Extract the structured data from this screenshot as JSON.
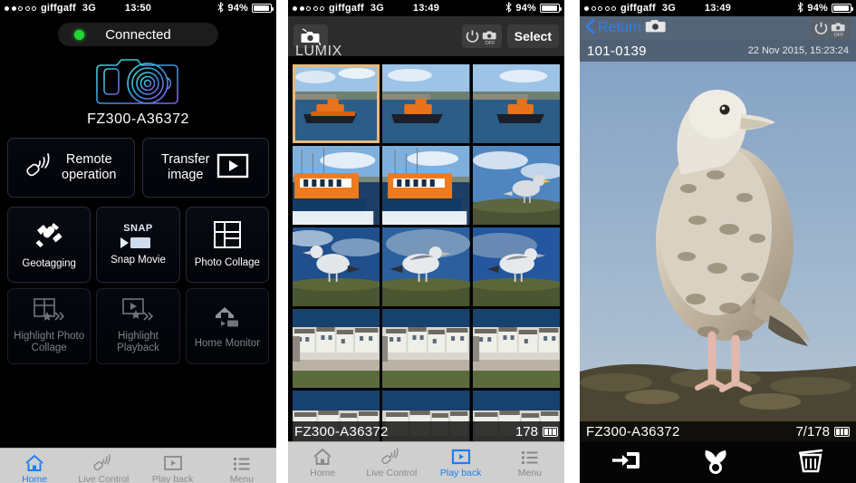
{
  "status_bar": {
    "carrier": "giffgaff",
    "network": "3G",
    "battery_percent": "94%",
    "bluetooth_icon": "bluetooth-icon",
    "time_panel1": "13:50",
    "time_panel2": "13:49",
    "time_panel3": "13:49",
    "signal_dots_panel1": 2,
    "signal_dots_panel2": 2,
    "signal_dots_panel3": 1
  },
  "panel1": {
    "connection": {
      "label": "Connected",
      "led_color": "#1fd832",
      "led_icon": "status-led-icon"
    },
    "camera_icon": "camera-illustration-icon",
    "camera_name": "FZ300-A36372",
    "primary_buttons": [
      {
        "label_line1": "Remote",
        "label_line2": "operation",
        "icon": "remote-control-icon"
      },
      {
        "label_line1": "Transfer",
        "label_line2": "image",
        "icon": "play-box-icon"
      }
    ],
    "features": [
      {
        "label": "Geotagging",
        "icon": "satellite-icon",
        "enabled": true
      },
      {
        "label": "Snap Movie",
        "icon": "snap-movie-icon",
        "badge": "SNAP",
        "enabled": true
      },
      {
        "label": "Photo Collage",
        "icon": "photo-collage-icon",
        "enabled": true
      },
      {
        "label": "Highlight Photo Collage",
        "icon": "highlight-photo-collage-icon",
        "enabled": false
      },
      {
        "label": "Highlight Playback",
        "icon": "highlight-playback-icon",
        "enabled": false
      },
      {
        "label": "Home Monitor",
        "icon": "home-monitor-icon",
        "enabled": false
      }
    ],
    "tabs": [
      {
        "label": "Home",
        "icon": "home-icon",
        "active": true
      },
      {
        "label": "Live Control",
        "icon": "remote-control-icon",
        "active": false
      },
      {
        "label": "Play back",
        "icon": "play-box-icon",
        "active": false
      },
      {
        "label": "Menu",
        "icon": "list-menu-icon",
        "active": false
      }
    ]
  },
  "panel2": {
    "header": {
      "camera_button_icon": "camera-return-icon",
      "power_button": {
        "icon": "power-icon",
        "label": "OFF"
      },
      "select_button": "Select"
    },
    "brand": "LUMIX",
    "thumbnails": [
      {
        "subject": "lifeboat-wide",
        "selected": true
      },
      {
        "subject": "lifeboat-wide",
        "selected": false
      },
      {
        "subject": "lifeboat-wide",
        "selected": false
      },
      {
        "subject": "lifeboat-moored",
        "selected": false
      },
      {
        "subject": "lifeboat-moored",
        "selected": false
      },
      {
        "subject": "seagull-grass",
        "selected": false
      },
      {
        "subject": "seagull-standing",
        "selected": false
      },
      {
        "subject": "seagull-walking",
        "selected": false
      },
      {
        "subject": "seagull-resting",
        "selected": false
      },
      {
        "subject": "harbour-village",
        "selected": false
      },
      {
        "subject": "harbour-village",
        "selected": false
      },
      {
        "subject": "harbour-village",
        "selected": false
      },
      {
        "subject": "harbour-village",
        "selected": false
      },
      {
        "subject": "harbour-village",
        "selected": false
      },
      {
        "subject": "harbour-village",
        "selected": false
      }
    ],
    "status_strip": {
      "camera_name": "FZ300-A36372",
      "count": "178",
      "battery_icon": "battery-icon"
    },
    "tabs": [
      {
        "label": "Home",
        "icon": "home-icon",
        "active": false
      },
      {
        "label": "Live Control",
        "icon": "remote-control-icon",
        "active": false
      },
      {
        "label": "Play back",
        "icon": "play-box-icon",
        "active": true
      },
      {
        "label": "Menu",
        "icon": "list-menu-icon",
        "active": false
      }
    ]
  },
  "panel3": {
    "header": {
      "back_label": "Return",
      "back_icon": "chevron-left-icon",
      "camera_icon": "camera-icon",
      "power_button": {
        "icon": "power-icon",
        "label": "OFF"
      }
    },
    "file_id": "101-0139",
    "timestamp": "22 Nov 2015, 15:23:24",
    "photo_subject": "seagull-on-rock",
    "status_strip": {
      "camera_name": "FZ300-A36372",
      "count": "7/178",
      "battery_icon": "battery-icon"
    },
    "toolbar": [
      {
        "icon": "save-to-phone-icon",
        "name": "save-button"
      },
      {
        "icon": "share-icon",
        "name": "share-button"
      },
      {
        "icon": "trash-icon",
        "name": "delete-button"
      }
    ]
  },
  "colors": {
    "accent_blue": "#1b7ef5",
    "selection_orange": "#e8b978",
    "led_green": "#1fd832",
    "tabbar_bg": "#cfcfcf"
  }
}
